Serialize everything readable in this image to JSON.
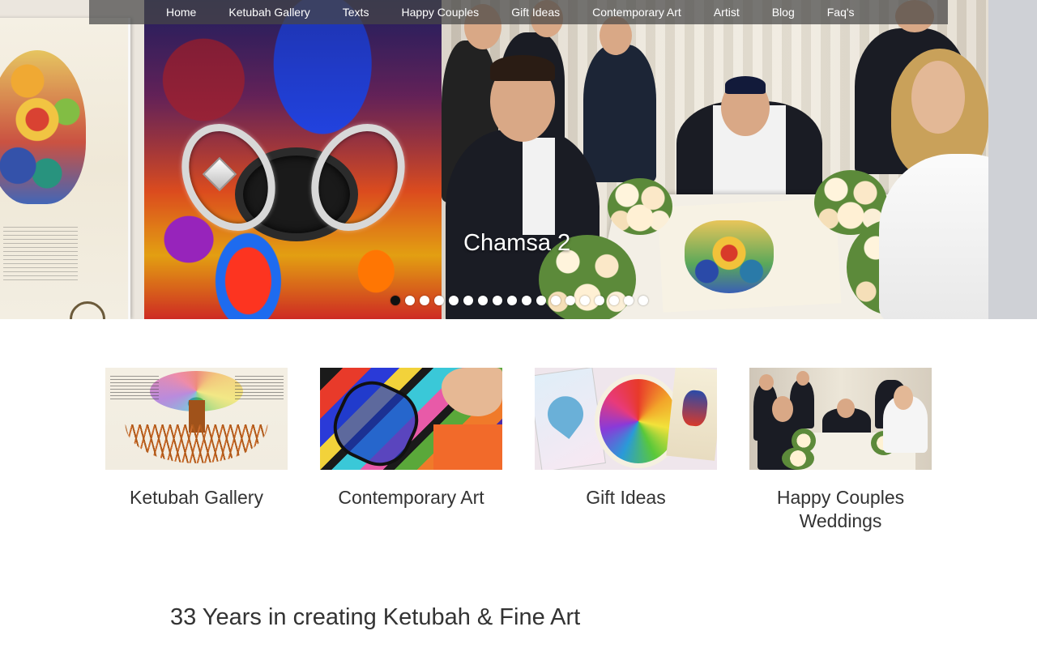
{
  "nav": {
    "items": [
      {
        "label": "Home"
      },
      {
        "label": "Ketubah Gallery"
      },
      {
        "label": "Texts"
      },
      {
        "label": "Happy Couples"
      },
      {
        "label": "Gift Ideas"
      },
      {
        "label": "Contemporary Art"
      },
      {
        "label": "Artist"
      },
      {
        "label": "Blog"
      },
      {
        "label": "Faq's"
      }
    ]
  },
  "slider": {
    "caption": "Chamsa 2",
    "dot_count": 18,
    "active_dot": 1
  },
  "categories": [
    {
      "label": "Ketubah Gallery"
    },
    {
      "label": "Contemporary Art"
    },
    {
      "label": "Gift Ideas"
    },
    {
      "label": "Happy Couples Weddings"
    }
  ],
  "tagline": "33 Years in creating Ketubah & Fine Art",
  "colors": {
    "nav_bg": "#464646",
    "text": "#333333",
    "active_dot": "#111111"
  }
}
